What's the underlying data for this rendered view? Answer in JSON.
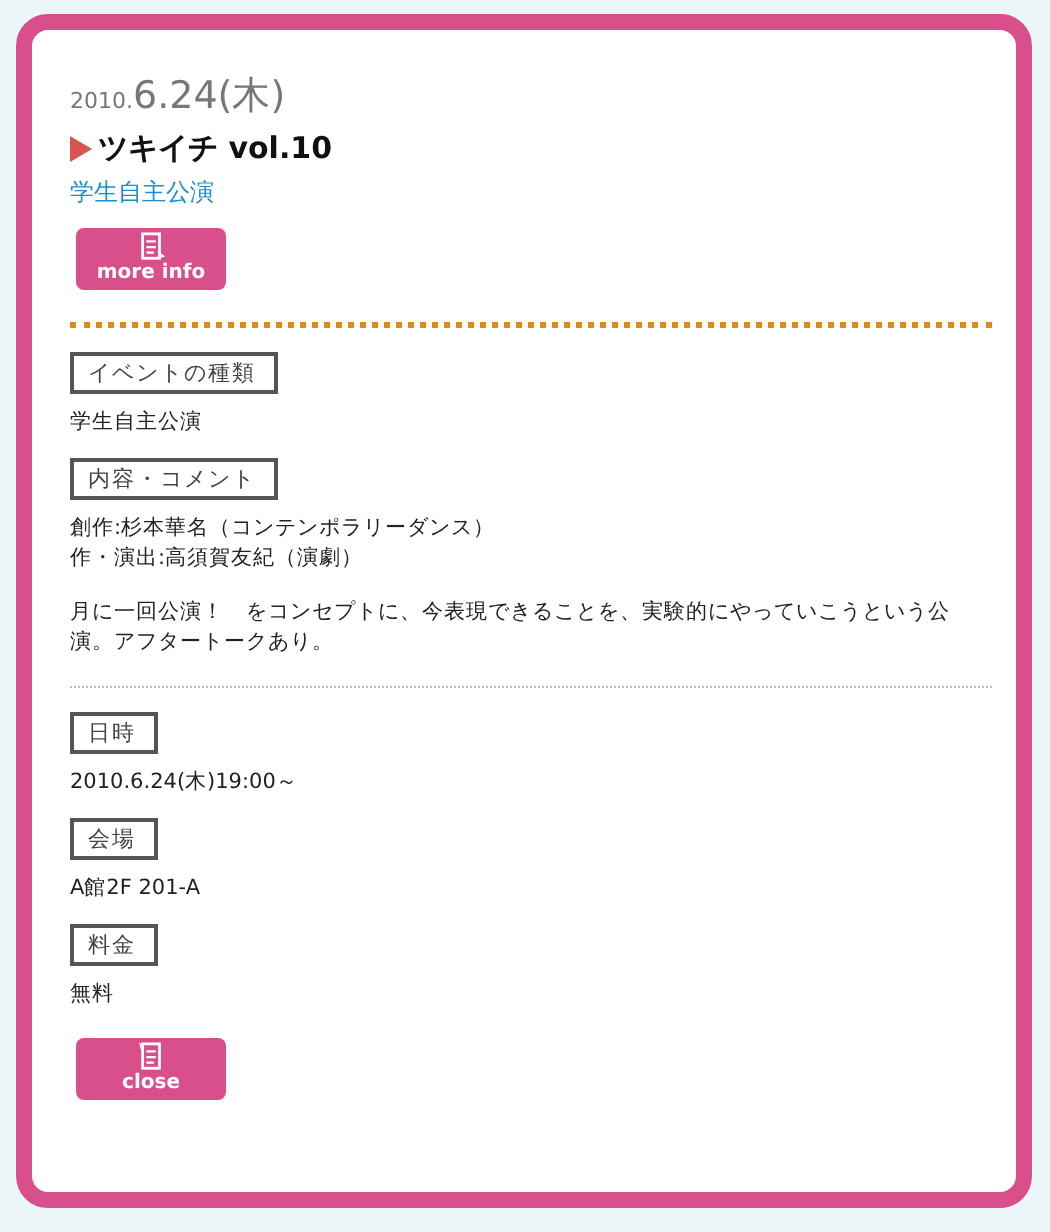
{
  "date": {
    "year": "2010.",
    "day": "6.24(木)"
  },
  "title": "ツキイチ vol.10",
  "category": "学生自主公演",
  "more_button": "more info",
  "groups": [
    {
      "sections": [
        {
          "label": "イベントの種類",
          "paragraphs": [
            [
              "学生自主公演"
            ]
          ]
        },
        {
          "label": "内容・コメント",
          "paragraphs": [
            [
              "創作:杉本華名（コンテンポラリーダンス）",
              "作・演出:高須賀友紀（演劇）"
            ],
            [
              "月に一回公演！　をコンセプトに、今表現できることを、実験的にやっていこうという公演。アフタートークあり。"
            ]
          ]
        }
      ]
    },
    {
      "sections": [
        {
          "label": "日時",
          "paragraphs": [
            [
              "2010.6.24(木)19:00～"
            ]
          ]
        },
        {
          "label": "会場",
          "paragraphs": [
            [
              "A館2F 201-A"
            ]
          ]
        },
        {
          "label": "料金",
          "paragraphs": [
            [
              "無料"
            ]
          ]
        }
      ]
    }
  ],
  "close_button": "close"
}
